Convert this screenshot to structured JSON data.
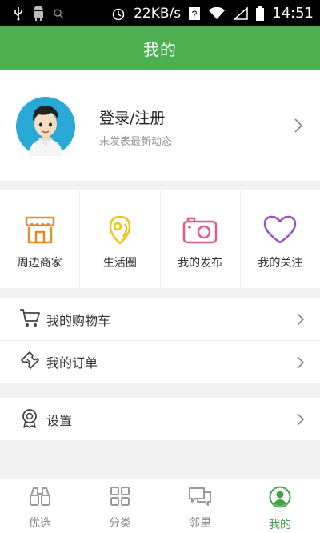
{
  "status_bar": {
    "speed": "22KB/s",
    "time": "14:51"
  },
  "header": {
    "title": "我的"
  },
  "profile": {
    "login_label": "登录/注册",
    "subtitle": "未发表最新动态"
  },
  "shortcuts": [
    {
      "label": "周边商家",
      "icon": "store-icon",
      "color": "#e68a2e"
    },
    {
      "label": "生活圈",
      "icon": "location-pin-icon",
      "color": "#f0c419"
    },
    {
      "label": "我的发布",
      "icon": "camera-icon",
      "color": "#e05a8a"
    },
    {
      "label": "我的关注",
      "icon": "heart-icon",
      "color": "#9b4fc2"
    }
  ],
  "menu": {
    "cart": "我的购物车",
    "orders": "我的订单",
    "settings": "设置"
  },
  "bottom_nav": [
    {
      "label": "优选",
      "icon": "binoculars-icon"
    },
    {
      "label": "分类",
      "icon": "grid-icon"
    },
    {
      "label": "邻里",
      "icon": "chat-icon"
    },
    {
      "label": "我的",
      "icon": "user-icon",
      "active": true
    }
  ],
  "colors": {
    "brand": "#4caf50",
    "active_tab": "#43a047"
  }
}
